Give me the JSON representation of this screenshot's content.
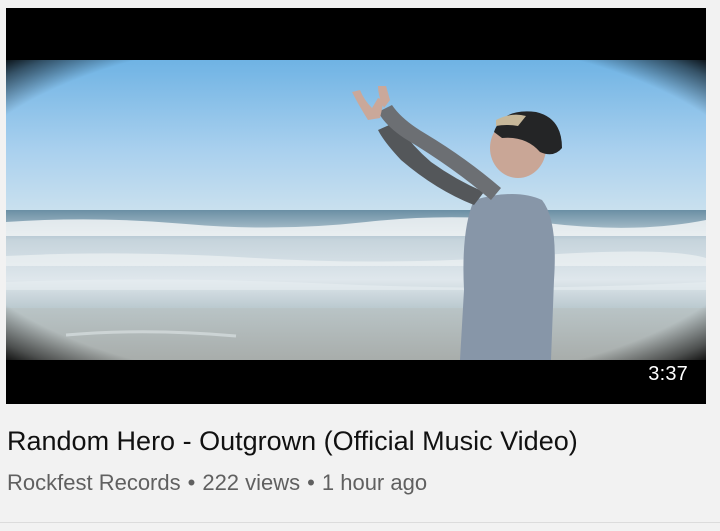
{
  "video": {
    "duration": "3:37",
    "title": "Random Hero - Outgrown (Official Music Video)",
    "channel": "Rockfest Records",
    "separator": "•",
    "views": "222 views",
    "age": "1 hour ago"
  },
  "colors": {
    "background": "#f2f2f2",
    "title": "#111111",
    "meta": "#606060",
    "letterbox": "#000000"
  }
}
